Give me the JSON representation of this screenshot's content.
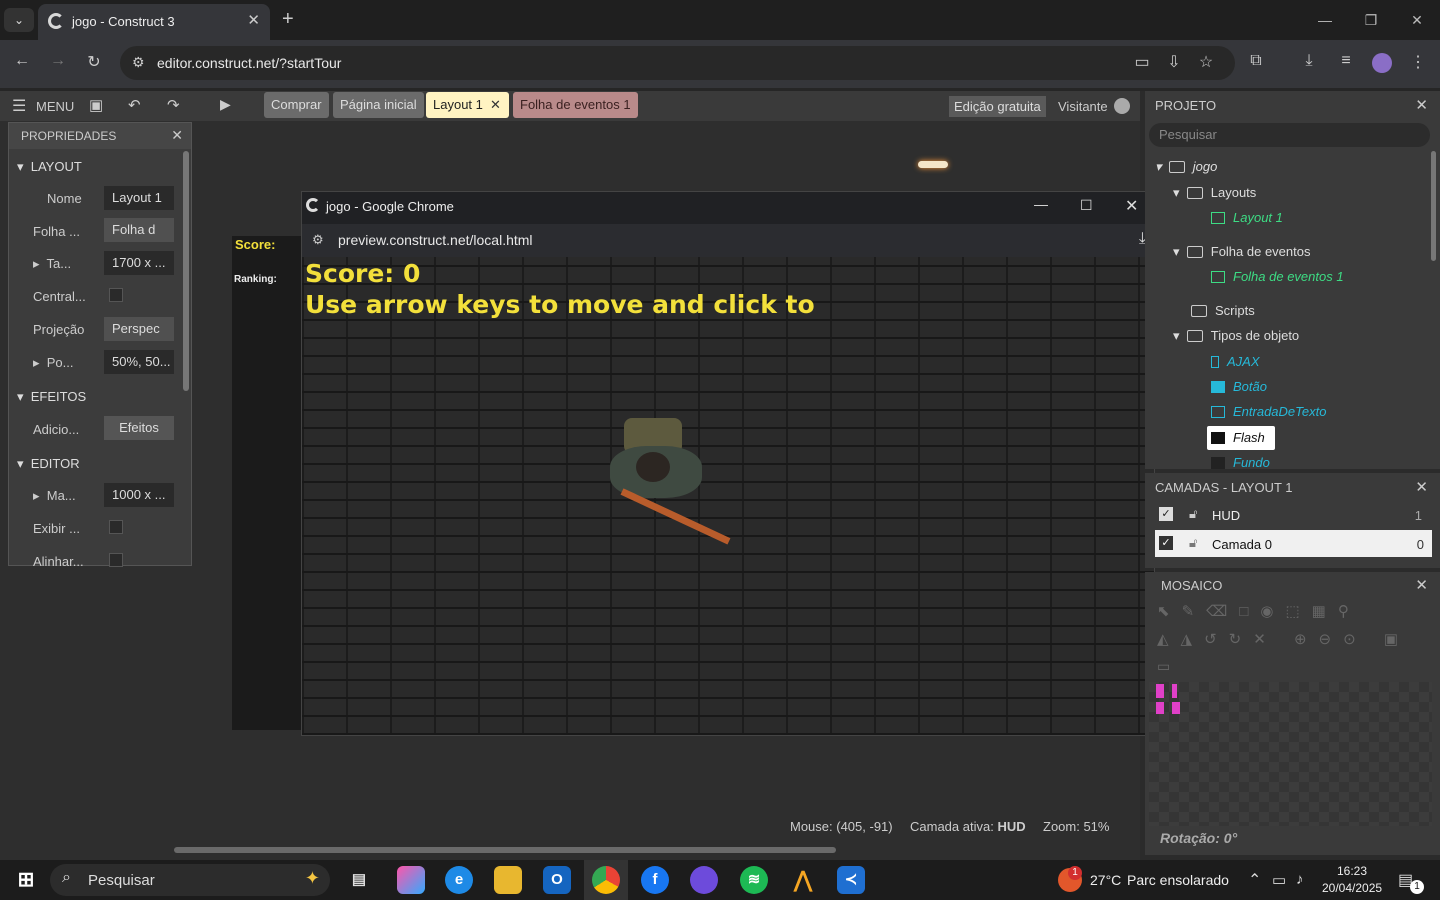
{
  "browser": {
    "tab_title": "jogo - Construct 3",
    "close_tab": "✕",
    "new_tab": "+",
    "url": "editor.construct.net/?startTour"
  },
  "editor": {
    "menu_label": "MENU",
    "tabs": [
      "Comprar",
      "Página inicial",
      "Layout 1",
      "Folha de eventos 1"
    ],
    "active_tab": "Layout 1",
    "edition_badge": "Edição gratuita",
    "user_label": "Visitante"
  },
  "properties": {
    "header": "PROPRIEDADES",
    "sections": {
      "layout": "LAYOUT",
      "effects": "EFEITOS",
      "editor": "EDITOR"
    },
    "rows": {
      "name_label": "Nome",
      "name_value": "Layout 1",
      "sheet_label": "Folha ...",
      "sheet_value": "Folha d",
      "size_label": "Ta...",
      "size_value": "1700 x ...",
      "central_label": "Central...",
      "projection_label": "Projeção",
      "projection_value": "Perspec",
      "pos_label": "Po...",
      "pos_value": "50%, 50...",
      "add_label": "Adicio...",
      "effects_btn": "Efeitos",
      "margin_label": "Ma...",
      "margin_value": "1000 x ...",
      "show_label": "Exibir ...",
      "align_label": "Alinhar..."
    }
  },
  "layout_view": {
    "score": "Score:",
    "ranking": "Ranking:"
  },
  "preview": {
    "title": "jogo - Google Chrome",
    "url": "preview.construct.net/local.html",
    "score": "Score: 0",
    "instructions": "Use arrow keys to move and click to"
  },
  "project": {
    "header": "PROJETO",
    "search_placeholder": "Pesquisar",
    "root": "jogo",
    "layouts_folder": "Layouts",
    "layout_item": "Layout 1",
    "events_folder": "Folha de eventos",
    "events_item": "Folha de eventos 1",
    "scripts_folder": "Scripts",
    "objects_folder": "Tipos de objeto",
    "objects": [
      "AJAX",
      "Botão",
      "EntradaDeTexto",
      "Flash",
      "Fundo"
    ]
  },
  "layers": {
    "header": "CAMADAS - LAYOUT 1",
    "items": [
      {
        "name": "HUD",
        "index": "1"
      },
      {
        "name": "Camada 0",
        "index": "0"
      }
    ]
  },
  "tilemap": {
    "header": "MOSAICO",
    "rotation": "Rotação: 0°"
  },
  "status": {
    "mouse": "Mouse: (405, -91)",
    "active_layer_label": "Camada ativa:",
    "active_layer_value": "HUD",
    "zoom": "Zoom: 51%"
  },
  "taskbar": {
    "search": "Pesquisar",
    "weather_temp": "27°C",
    "weather_desc": "Parc ensolarado",
    "time": "16:23",
    "date": "20/04/2025",
    "weather_badge": "1",
    "notif_badge": "1"
  },
  "colors": {
    "accent_yellow": "#f3e03b",
    "layout_green": "#3ddc84",
    "object_cyan": "#26b9d9"
  }
}
